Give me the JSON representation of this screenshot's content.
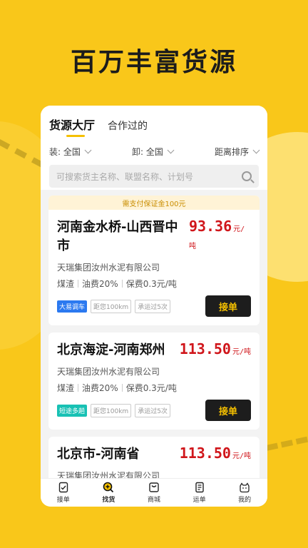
{
  "banner": {
    "title": "百万丰富货源"
  },
  "tabs": [
    {
      "label": "货源大厅",
      "active": true
    },
    {
      "label": "合作过的",
      "active": false
    }
  ],
  "filters": {
    "load": "装: 全国",
    "unload": "卸: 全国",
    "sort": "距离排序"
  },
  "search": {
    "placeholder": "可搜索货主名称、联盟名称、计划号"
  },
  "cards": [
    {
      "notice": "需支付保证金100元",
      "route": "河南金水桥-山西晋中市",
      "price": "93.36",
      "unit": "元/吨",
      "company": "天瑞集团汝州水泥有限公司",
      "cargo": "煤渣",
      "oil": "油费20%",
      "insurance": "保费0.3元/吨",
      "badge": "大易调车",
      "distance": "距您100km",
      "trips": "承运过5次",
      "button": "接单"
    },
    {
      "route": "北京海淀-河南郑州",
      "price": "113.50",
      "unit": "元/吨",
      "company": "天瑞集团汝州水泥有限公司",
      "cargo": "煤渣",
      "oil": "油费20%",
      "insurance": "保费0.3元/吨",
      "badge": "短途多趟",
      "distance": "距您100km",
      "trips": "承运过5次",
      "button": "接单"
    },
    {
      "route": "北京市-河南省",
      "price": "113.50",
      "unit": "元/吨",
      "company": "天瑞集团汝州水泥有限公司"
    }
  ],
  "nav": [
    {
      "label": "接单",
      "icon": "order-check-icon"
    },
    {
      "label": "找货",
      "icon": "search-goods-icon"
    },
    {
      "label": "商城",
      "icon": "shop-bag-icon"
    },
    {
      "label": "运单",
      "icon": "waybill-icon"
    },
    {
      "label": "我的",
      "icon": "profile-icon"
    }
  ],
  "colors": {
    "background": "#f9c71a",
    "price": "#d0161b",
    "button_bg": "#1d1d1d",
    "button_text": "#f5c000",
    "notice_bg": "#fff3d6"
  }
}
